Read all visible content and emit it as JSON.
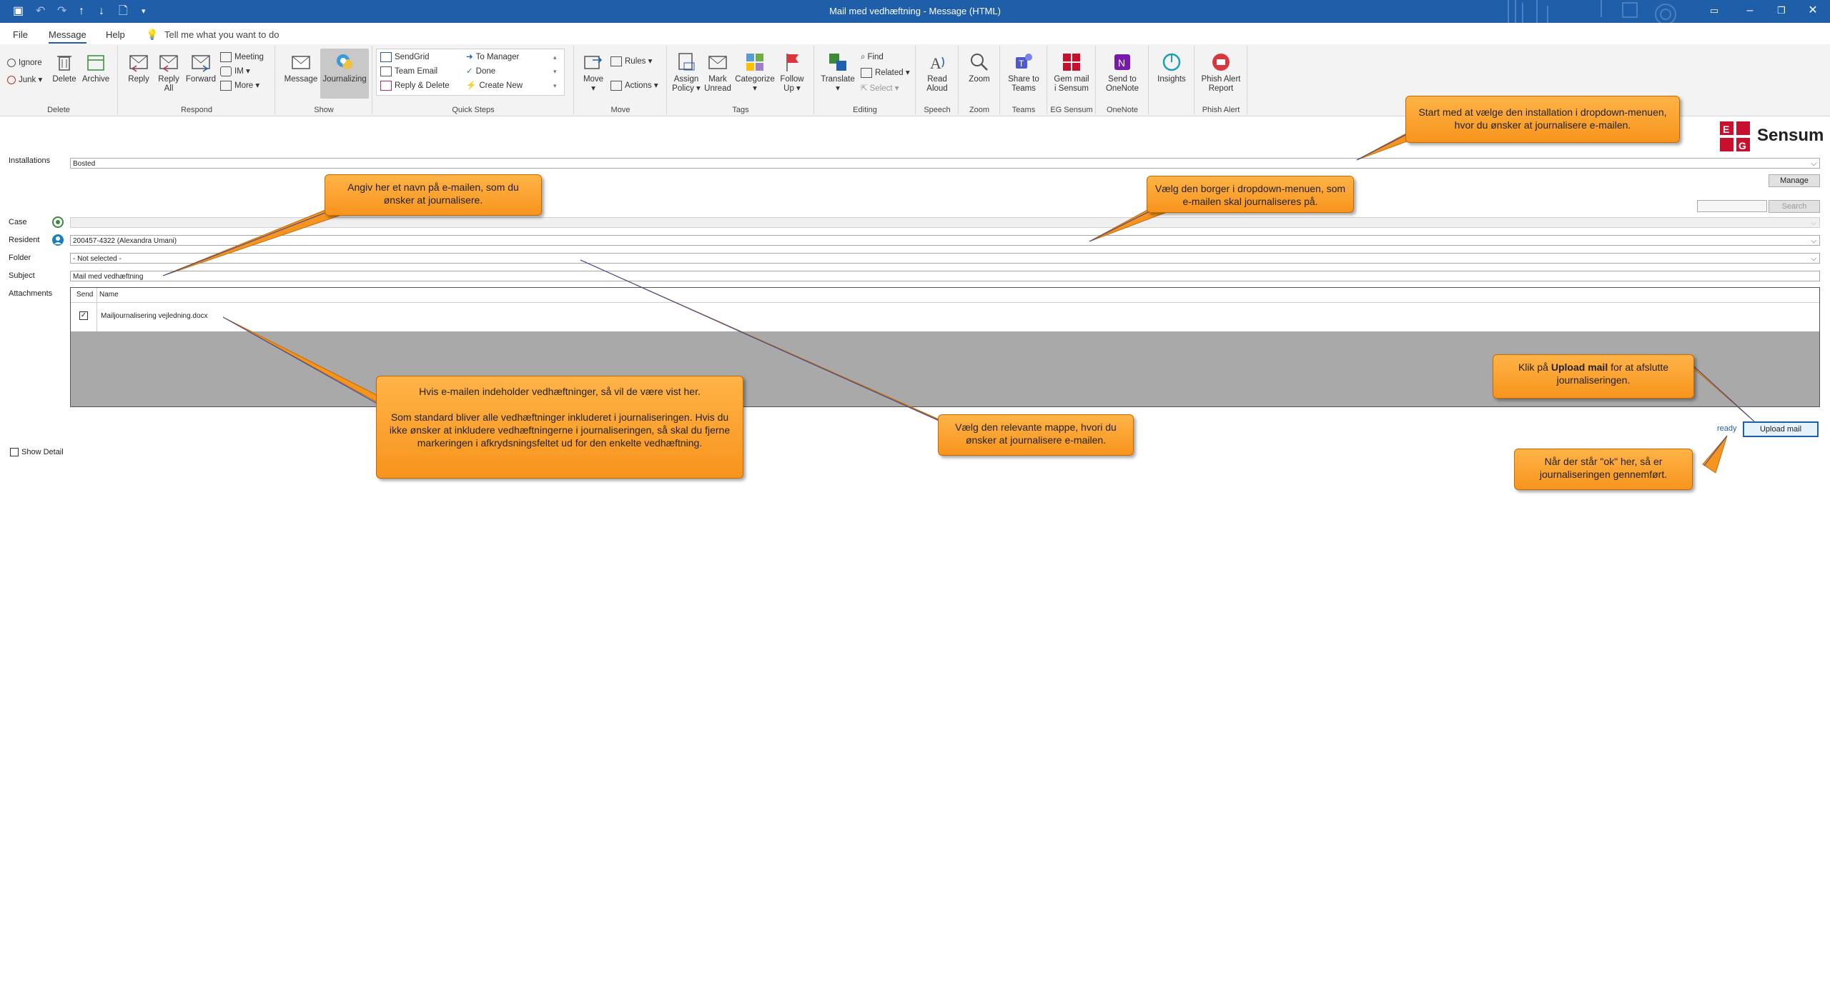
{
  "window": {
    "title": "Mail med vedhæftning  -  Message (HTML)"
  },
  "menu": {
    "file": "File",
    "message": "Message",
    "help": "Help",
    "tell_me": "Tell me what you want to do"
  },
  "ribbon": {
    "delete_group": {
      "label": "Delete",
      "ignore": "Ignore",
      "junk": "Junk",
      "delete": "Delete",
      "archive": "Archive"
    },
    "respond_group": {
      "label": "Respond",
      "reply": "Reply",
      "reply_all_1": "Reply",
      "reply_all_2": "All",
      "forward": "Forward",
      "meeting": "Meeting",
      "im": "IM",
      "more": "More"
    },
    "show_group": {
      "label": "Show",
      "message": "Message",
      "journalizing": "Journalizing"
    },
    "quick_steps": {
      "label": "Quick Steps",
      "items": [
        "SendGrid",
        "Team Email",
        "Reply & Delete",
        "To Manager",
        "Done",
        "Create New"
      ]
    },
    "move_group": {
      "label": "Move",
      "move": "Move",
      "rules": "Rules",
      "actions": "Actions"
    },
    "tags_group": {
      "label": "Tags",
      "assign_1": "Assign",
      "assign_2": "Policy",
      "mark_1": "Mark",
      "mark_2": "Unread",
      "categorize": "Categorize",
      "follow_1": "Follow",
      "follow_2": "Up"
    },
    "editing_group": {
      "label": "Editing",
      "translate": "Translate",
      "find": "Find",
      "related": "Related",
      "select": "Select"
    },
    "speech_group": {
      "label": "Speech",
      "read_1": "Read",
      "read_2": "Aloud"
    },
    "zoom_group": {
      "label": "Zoom",
      "zoom": "Zoom"
    },
    "teams_group": {
      "label": "Teams",
      "share_1": "Share to",
      "share_2": "Teams"
    },
    "sensum_group": {
      "label": "EG Sensum",
      "gem_1": "Gem mail",
      "gem_2": "i Sensum"
    },
    "onenote_group": {
      "label": "OneNote",
      "send_1": "Send to",
      "send_2": "OneNote"
    },
    "insights_group": {
      "label": "",
      "insights": "Insights"
    },
    "phish_group": {
      "label": "Phish Alert",
      "phish_1": "Phish Alert",
      "phish_2": "Report"
    }
  },
  "logo": {
    "text": "Sensum",
    "mark": "EG"
  },
  "form": {
    "installations_label": "Installations",
    "installations_value": "Bosted",
    "manage_button": "Manage",
    "search_button": "Search",
    "case_label": "Case",
    "case_value": "",
    "resident_label": "Resident",
    "resident_value": "200457-4322 (Alexandra Umani)",
    "folder_label": "Folder",
    "folder_value": "- Not selected -",
    "subject_label": "Subject",
    "subject_value": "Mail med vedhæftning",
    "attachments_label": "Attachments",
    "attachments_headers": [
      "Send",
      "Name"
    ],
    "attachments": [
      {
        "send": true,
        "name": "Mailjournalisering vejledning.docx"
      }
    ],
    "show_detail": "Show Detail",
    "status": "ready",
    "upload_button": "Upload mail"
  },
  "callouts": {
    "install": "Start med at vælge den installation i dropdown-menuen, hvor du ønsker at journalisere e-mailen.",
    "subject": "Angiv her et navn på e-mailen, som du ønsker at journalisere.",
    "resident": "Vælg den borger i dropdown-menuen, som e-mailen skal journaliseres på.",
    "attach_1": "Hvis e-mailen indeholder vedhæftninger, så vil de være vist her.",
    "attach_2": "Som standard bliver alle vedhæftninger inkluderet i journaliseringen. Hvis du ikke ønsker at inkludere vedhæftningerne i journaliseringen, så skal du fjerne markeringen i afkrydsningsfeltet ud for den enkelte vedhæftning.",
    "folder": "Vælg den relevante mappe, hvori du ønsker at journalisere e-mailen.",
    "upload_pre": "Klik på ",
    "upload_bold": "Upload mail",
    "upload_post": " for at afslutte journaliseringen.",
    "ok": "Når der står \"ok\" her, så er journaliseringen gennemført."
  },
  "colors": {
    "titlebar": "#1f5fa9",
    "callout": "#f7941d",
    "attach_area": "#a9a9a9",
    "upload_border": "#1f5fa9"
  }
}
